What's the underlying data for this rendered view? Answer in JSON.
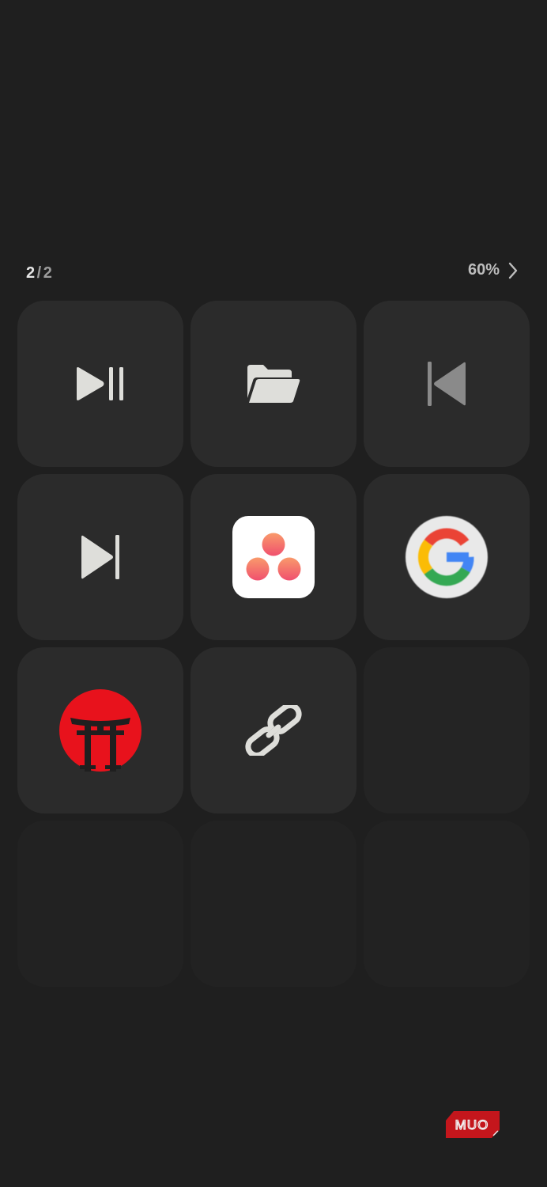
{
  "pager": {
    "current": "2",
    "separator": "/",
    "total": "2"
  },
  "zoom": {
    "label": "60%",
    "icon": "chevron-right-icon"
  },
  "tiles": [
    {
      "id": "play-pause",
      "icon": "play-pause-icon",
      "color": "#dededa"
    },
    {
      "id": "folder",
      "icon": "folder-open-icon",
      "color": "#dededa"
    },
    {
      "id": "previous-track",
      "icon": "skip-previous-icon",
      "color": "#8a8a8a"
    },
    {
      "id": "next-track",
      "icon": "skip-next-icon",
      "color": "#dededa"
    },
    {
      "id": "asana",
      "icon": "asana-logo-icon",
      "colors": [
        "#f06a6a",
        "#f99a6b"
      ]
    },
    {
      "id": "google",
      "icon": "google-logo-icon",
      "colors": [
        "#ea4335",
        "#fbbc05",
        "#34a853",
        "#4285f4"
      ]
    },
    {
      "id": "shrine",
      "icon": "torii-gate-icon",
      "color": "#e8121c"
    },
    {
      "id": "link",
      "icon": "link-icon",
      "color": "#dededa"
    },
    {
      "id": "empty-1",
      "icon": null
    },
    {
      "id": "empty-2",
      "icon": null
    },
    {
      "id": "empty-3",
      "icon": null
    },
    {
      "id": "empty-4",
      "icon": null
    }
  ],
  "watermark": {
    "text": "MUO",
    "color": "#c4161c"
  }
}
